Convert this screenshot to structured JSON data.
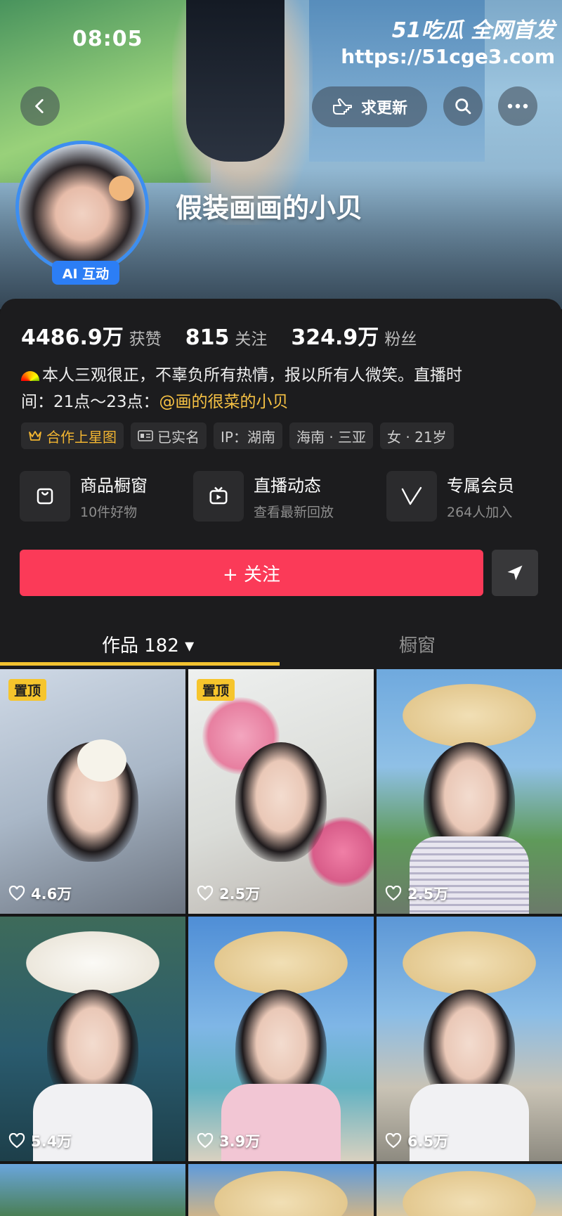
{
  "status_bar": {
    "time": "08:05"
  },
  "watermark": {
    "brand": "51吃瓜 全网首发",
    "url": "https://51cge3.com"
  },
  "top_bar": {
    "request_update_label": "求更新"
  },
  "profile": {
    "name": "假装画画的小贝",
    "ai_badge": "AI 互动",
    "stats": [
      {
        "value": "4486.9万",
        "label": "获赞"
      },
      {
        "value": "815",
        "label": "关注"
      },
      {
        "value": "324.9万",
        "label": "粉丝"
      }
    ],
    "bio_line1": "本人三观很正，不辜负所有热情，报以所有人微笑。直播时",
    "bio_line2": "间：21点～23点：",
    "bio_mention": "@画的很菜的小贝",
    "tags": [
      "合作上星图",
      "已实名",
      "IP：湖南",
      "海南 · 三亚",
      "女 · 21岁"
    ]
  },
  "services": [
    {
      "title": "商品橱窗",
      "subtitle": "10件好物"
    },
    {
      "title": "直播动态",
      "subtitle": "查看最新回放"
    },
    {
      "title": "专属会员",
      "subtitle": "264人加入"
    }
  ],
  "actions": {
    "follow_label": "+ 关注"
  },
  "tabs": [
    {
      "label": "作品 182 ▾"
    },
    {
      "label": "橱窗"
    }
  ],
  "grid": {
    "pinned_label": "置顶",
    "items": [
      {
        "likes": "4.6万"
      },
      {
        "likes": "2.5万"
      },
      {
        "likes": "2.5万"
      },
      {
        "likes": "5.4万"
      },
      {
        "likes": "3.9万"
      },
      {
        "likes": "6.5万"
      }
    ]
  },
  "colors": {
    "accent": "#fb3a58",
    "badge": "#2c7ef5",
    "highlight": "#f2c230",
    "background": "#161616"
  }
}
